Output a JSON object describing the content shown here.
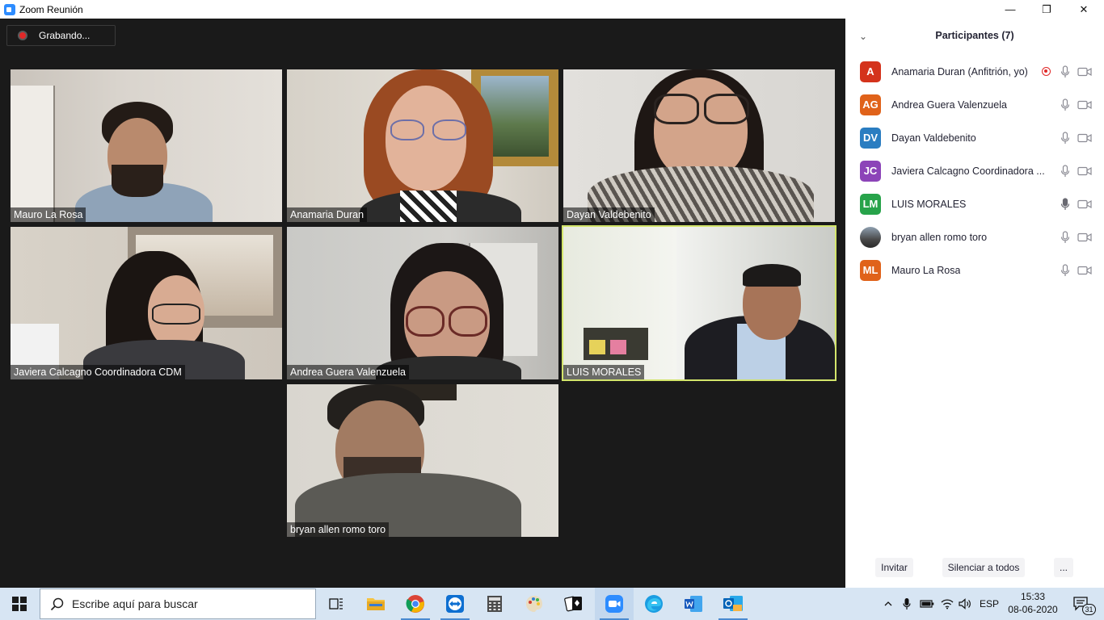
{
  "window": {
    "title": "Zoom Reunión",
    "minimize_glyph": "—",
    "maximize_glyph": "❐",
    "close_glyph": "✕"
  },
  "recording": {
    "label": "Grabando..."
  },
  "tiles": [
    {
      "name": "Mauro La Rosa"
    },
    {
      "name": "Anamaria Duran"
    },
    {
      "name": "Dayan Valdebenito"
    },
    {
      "name": "Javiera Calcagno Coordinadora CDM"
    },
    {
      "name": "Andrea Guera Valenzuela"
    },
    {
      "name": "LUIS MORALES"
    },
    {
      "name": "bryan allen romo toro"
    }
  ],
  "panel": {
    "collapse_glyph": "⌄",
    "title": "Participantes (7)",
    "participants": [
      {
        "initials": "A",
        "name": "Anamaria Duran (Anfitrión, yo)",
        "color": "#d4331c"
      },
      {
        "initials": "AG",
        "name": "Andrea Guera Valenzuela",
        "color": "#e0621a"
      },
      {
        "initials": "DV",
        "name": "Dayan Valdebenito",
        "color": "#2a7dc1"
      },
      {
        "initials": "JC",
        "name": "Javiera Calcagno Coordinadora ...",
        "color": "#8c44b8"
      },
      {
        "initials": "LM",
        "name": "LUIS MORALES",
        "color": "#27a34a"
      },
      {
        "initials": "",
        "name": "bryan allen romo toro",
        "color": "#6b6b6b"
      },
      {
        "initials": "ML",
        "name": "Mauro La Rosa",
        "color": "#e0621a"
      }
    ],
    "invite_label": "Invitar",
    "mute_all_label": "Silenciar a todos",
    "more_label": "..."
  },
  "taskbar": {
    "search_placeholder": "Escribe aquí para buscar",
    "language": "ESP",
    "time": "15:33",
    "date": "08-06-2020",
    "notification_count": "31"
  },
  "colors": {
    "accent": "#2d8cff",
    "active_speaker": "#d3e56b",
    "record": "#e02828"
  }
}
